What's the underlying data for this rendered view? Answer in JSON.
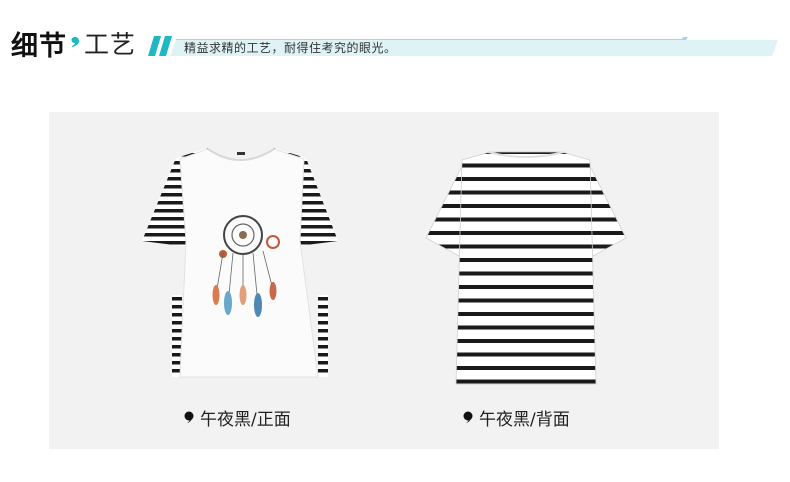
{
  "header": {
    "title_bold": "细节",
    "title_light": "工艺",
    "ribbon_text": "精益求精的工艺，耐得住考究的眼光。",
    "accent_color": "#1fb7c4"
  },
  "products": [
    {
      "caption": "午夜黑/正面"
    },
    {
      "caption": "午夜黑/背面"
    }
  ],
  "icons": {
    "comma": "comma-icon",
    "bullet": "bullet-dot-icon"
  }
}
